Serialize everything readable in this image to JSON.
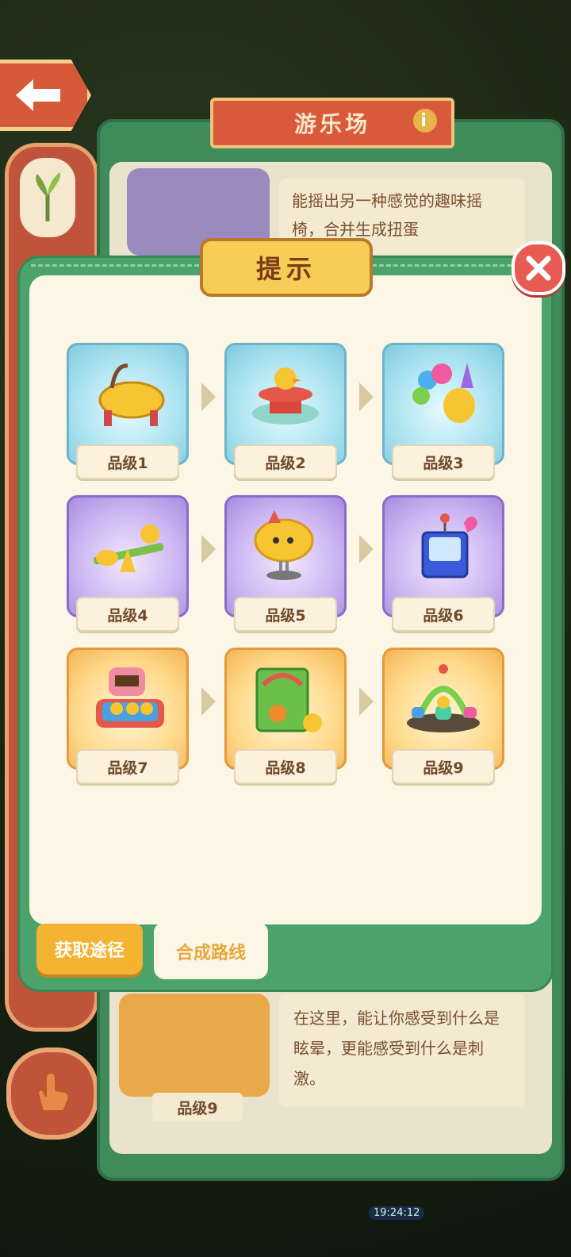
{
  "background": {
    "title": "游乐场",
    "desc_top": "能摇出另一种感觉的趣味摇椅，合并生成扭蛋",
    "desc_bottom": "在这里，能让你感受到什么是眩晕，更能感受到什么是刺激。",
    "grade_bottom": "品级9",
    "clock": "19:24:12"
  },
  "modal": {
    "title": "提示",
    "items": [
      {
        "label": "品级1",
        "tier": "blue",
        "icon": "rocking-horse-icon"
      },
      {
        "label": "品级2",
        "tier": "blue",
        "icon": "duck-carousel-icon"
      },
      {
        "label": "品级3",
        "tier": "blue",
        "icon": "balloons-icon"
      },
      {
        "label": "品级4",
        "tier": "purple",
        "icon": "seesaw-icon"
      },
      {
        "label": "品级5",
        "tier": "purple",
        "icon": "spring-rider-icon"
      },
      {
        "label": "品级6",
        "tier": "purple",
        "icon": "gacha-machine-icon"
      },
      {
        "label": "品级7",
        "tier": "gold",
        "icon": "whack-a-duck-icon"
      },
      {
        "label": "品级8",
        "tier": "gold",
        "icon": "basketball-arcade-icon"
      },
      {
        "label": "品级9",
        "tier": "gold",
        "icon": "teacup-ride-icon"
      }
    ],
    "tabs": {
      "get": "获取途径",
      "route": "合成路线"
    }
  },
  "colors": {
    "panel_green": "#4ba36b",
    "title_yellow": "#f6cd56",
    "close_red": "#e85b52",
    "tab_orange": "#f5b332"
  }
}
